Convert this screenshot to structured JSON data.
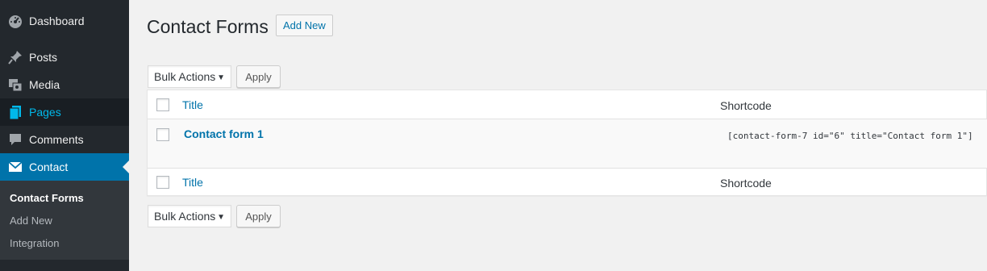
{
  "sidebar": {
    "items": [
      {
        "label": "Dashboard",
        "icon": "dashboard-icon"
      },
      {
        "label": "Posts",
        "icon": "pin-icon"
      },
      {
        "label": "Media",
        "icon": "media-icon"
      },
      {
        "label": "Pages",
        "icon": "pages-icon"
      },
      {
        "label": "Comments",
        "icon": "comment-icon"
      },
      {
        "label": "Contact",
        "icon": "mail-icon"
      }
    ],
    "submenu": [
      "Contact Forms",
      "Add New",
      "Integration"
    ]
  },
  "header": {
    "title": "Contact Forms",
    "add_new_label": "Add New"
  },
  "bulk_actions": {
    "selected": "Bulk Actions",
    "apply_label": "Apply"
  },
  "table": {
    "columns": {
      "title": "Title",
      "shortcode": "Shortcode"
    },
    "rows": [
      {
        "title": "Contact form 1",
        "shortcode": "[contact-form-7 id=\"6\" title=\"Contact form 1\"]"
      }
    ]
  },
  "colors": {
    "sidebar_bg": "#23282d",
    "active_menu": "#0073aa",
    "link": "#0073aa",
    "pages_highlight": "#00b9eb"
  }
}
